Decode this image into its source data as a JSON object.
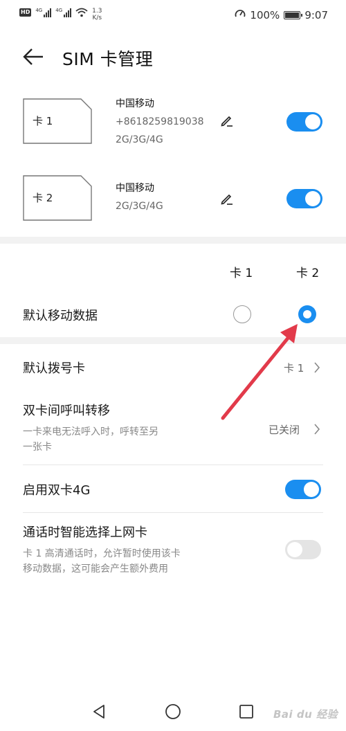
{
  "status_bar": {
    "hd_badge": "HD",
    "signal1_label": "4G",
    "signal2_label": "4G",
    "net_speed_value": "1.3",
    "net_speed_unit": "K/s",
    "battery_text": "100%",
    "time": "9:07"
  },
  "header": {
    "title": "SIM 卡管理"
  },
  "sims": [
    {
      "card_label": "卡 1",
      "carrier": "中国移动",
      "number": "+8618259819038",
      "networks": "2G/3G/4G",
      "enabled": true
    },
    {
      "card_label": "卡 2",
      "carrier": "中国移动",
      "networks": "2G/3G/4G",
      "enabled": true
    }
  ],
  "default_data": {
    "col1": "卡 1",
    "col2": "卡 2",
    "label": "默认移动数据",
    "selected": "卡 2"
  },
  "settings": {
    "default_dial": {
      "label": "默认拨号卡",
      "value": "卡 1"
    },
    "call_forward": {
      "label": "双卡间呼叫转移",
      "desc_line1": "一卡来电无法呼入时，呼转至另",
      "desc_line2": "一张卡",
      "value": "已关闭"
    },
    "dual_4g": {
      "label": "启用双卡4G",
      "enabled": true
    },
    "smart_data": {
      "label": "通话时智能选择上网卡",
      "desc_line1": "卡 1 高清通话时，允许暂时使用该卡",
      "desc_line2": "移动数据，这可能会产生额外费用",
      "enabled": false
    }
  },
  "watermark": "Bai du 经验",
  "colors": {
    "accent": "#1a8ef0",
    "annotation_arrow": "#e23a4a"
  }
}
